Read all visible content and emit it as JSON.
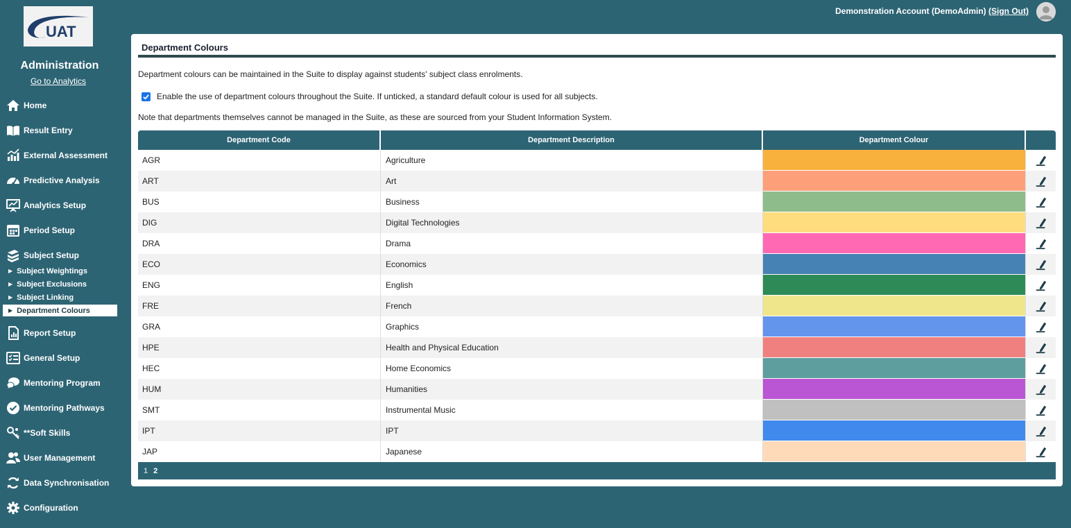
{
  "sidebar": {
    "logo_text": "UAT",
    "title": "Administration",
    "analytics_link": "Go to Analytics",
    "items": [
      {
        "label": "Home",
        "icon": "home-icon"
      },
      {
        "label": "Result Entry",
        "icon": "book-icon"
      },
      {
        "label": "External Assessment",
        "icon": "chart-icon"
      },
      {
        "label": "Predictive Analysis",
        "icon": "gauge-icon"
      },
      {
        "label": "Analytics Setup",
        "icon": "presentation-icon"
      },
      {
        "label": "Period Setup",
        "icon": "calendar-icon"
      },
      {
        "label": "Subject Setup",
        "icon": "books-icon"
      }
    ],
    "subitems": [
      {
        "label": "Subject Weightings"
      },
      {
        "label": "Subject Exclusions"
      },
      {
        "label": "Subject Linking"
      },
      {
        "label": "Department Colours",
        "active": true
      }
    ],
    "items2": [
      {
        "label": "Report Setup",
        "icon": "report-icon"
      },
      {
        "label": "General Setup",
        "icon": "checklist-icon"
      },
      {
        "label": "Mentoring Program",
        "icon": "chat-icon"
      },
      {
        "label": "Mentoring Pathways",
        "icon": "badge-check-icon"
      },
      {
        "label": "**Soft Skills",
        "icon": "skills-icon"
      },
      {
        "label": "User Management",
        "icon": "users-icon"
      },
      {
        "label": "Data Synchronisation",
        "icon": "sync-icon"
      },
      {
        "label": "Configuration",
        "icon": "gear-icon"
      }
    ]
  },
  "header": {
    "account": "Demonstration Account (DemoAdmin)",
    "signout": "(Sign Out)"
  },
  "panel": {
    "title": "Department Colours",
    "description": "Department colours can be maintained in the Suite to display against students' subject class enrolments.",
    "checkbox_label": "Enable the use of department colours throughout the Suite. If unticked, a standard default colour is used for all subjects.",
    "checkbox_checked": true,
    "note": "Note that departments themselves cannot be managed in the Suite, as these are sourced from your Student Information System."
  },
  "table": {
    "headers": [
      "Department Code",
      "Department Description",
      "Department Colour"
    ],
    "rows": [
      {
        "code": "AGR",
        "desc": "Agriculture",
        "colour": "#f8b13d"
      },
      {
        "code": "ART",
        "desc": "Art",
        "colour": "#fda07a"
      },
      {
        "code": "BUS",
        "desc": "Business",
        "colour": "#8fbc8b"
      },
      {
        "code": "DIG",
        "desc": "Digital Technologies",
        "colour": "#fedd7f"
      },
      {
        "code": "DRA",
        "desc": "Drama",
        "colour": "#ff69b4"
      },
      {
        "code": "ECO",
        "desc": "Economics",
        "colour": "#4782b4"
      },
      {
        "code": "ENG",
        "desc": "English",
        "colour": "#2e8b57"
      },
      {
        "code": "FRE",
        "desc": "French",
        "colour": "#efe68c"
      },
      {
        "code": "GRA",
        "desc": "Graphics",
        "colour": "#6495ed"
      },
      {
        "code": "HPE",
        "desc": "Health and Physical Education",
        "colour": "#f08080"
      },
      {
        "code": "HEC",
        "desc": "Home Economics",
        "colour": "#5f9e9f"
      },
      {
        "code": "HUM",
        "desc": "Humanities",
        "colour": "#ba55d3"
      },
      {
        "code": "SMT",
        "desc": "Instrumental Music",
        "colour": "#c0c0c0"
      },
      {
        "code": "IPT",
        "desc": "IPT",
        "colour": "#4189ec"
      },
      {
        "code": "JAP",
        "desc": "Japanese",
        "colour": "#ffdab9"
      }
    ],
    "pages": [
      "1",
      "2"
    ],
    "current_page": "1"
  }
}
